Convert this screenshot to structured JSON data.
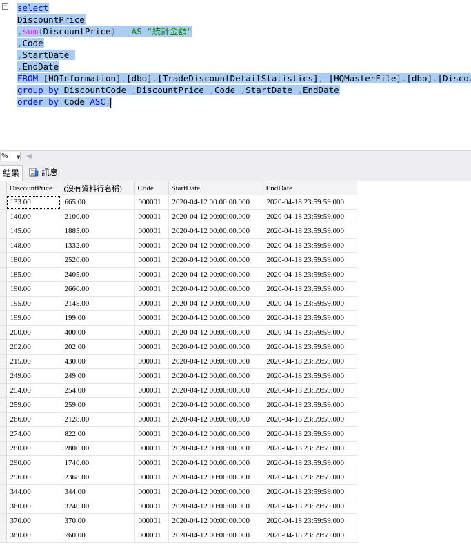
{
  "editor": {
    "lines": [
      {
        "parts": [
          {
            "cls": "kw",
            "text": "select"
          }
        ]
      },
      {
        "parts": [
          {
            "cls": "tx",
            "text": "DiscountPrice"
          }
        ]
      },
      {
        "parts": [
          {
            "cls": "op",
            "text": ","
          },
          {
            "cls": "fn",
            "text": "sum"
          },
          {
            "cls": "op",
            "text": "("
          },
          {
            "cls": "tx",
            "text": "DiscountPrice"
          },
          {
            "cls": "op",
            "text": ")"
          },
          {
            "cls": "tx",
            "text": " "
          },
          {
            "cls": "cm",
            "text": "--AS \"統計金額\""
          }
        ]
      },
      {
        "parts": [
          {
            "cls": "op",
            "text": ","
          },
          {
            "cls": "tx",
            "text": "Code"
          }
        ]
      },
      {
        "parts": [
          {
            "cls": "op",
            "text": ","
          },
          {
            "cls": "tx",
            "text": "StartDate "
          }
        ]
      },
      {
        "parts": [
          {
            "cls": "op",
            "text": ","
          },
          {
            "cls": "tx",
            "text": "EndDate"
          }
        ]
      },
      {
        "parts": [
          {
            "cls": "kw",
            "text": "FROM"
          },
          {
            "cls": "tx",
            "text": " [HQInformation]"
          },
          {
            "cls": "op",
            "text": "."
          },
          {
            "cls": "tx",
            "text": "[dbo]"
          },
          {
            "cls": "op",
            "text": "."
          },
          {
            "cls": "tx",
            "text": "[TradeDiscountDetailStatistics]"
          },
          {
            "cls": "op",
            "text": ","
          },
          {
            "cls": "tx",
            "text": " [HQMasterFile]"
          },
          {
            "cls": "op",
            "text": "."
          },
          {
            "cls": "tx",
            "text": "[dbo]"
          },
          {
            "cls": "op",
            "text": "."
          },
          {
            "cls": "tx",
            "text": "[Discount]"
          }
        ]
      },
      {
        "parts": [
          {
            "cls": "kw",
            "text": "group by"
          },
          {
            "cls": "tx",
            "text": " DiscountCode "
          },
          {
            "cls": "op",
            "text": ","
          },
          {
            "cls": "tx",
            "text": "DiscountPrice "
          },
          {
            "cls": "op",
            "text": ","
          },
          {
            "cls": "tx",
            "text": "Code "
          },
          {
            "cls": "op",
            "text": ","
          },
          {
            "cls": "tx",
            "text": "StartDate "
          },
          {
            "cls": "op",
            "text": ","
          },
          {
            "cls": "tx",
            "text": "EndDate"
          }
        ]
      },
      {
        "parts": [
          {
            "cls": "kw",
            "text": "order by"
          },
          {
            "cls": "tx",
            "text": " Code "
          },
          {
            "cls": "kw",
            "text": "ASC"
          },
          {
            "cls": "op",
            "text": ";"
          }
        ],
        "caret": true
      }
    ]
  },
  "zoom": {
    "value": "%"
  },
  "tabs": {
    "results": "結果",
    "messages": "訊息"
  },
  "grid": {
    "columns": [
      "DiscountPrice",
      "(沒有資料行名稱)",
      "Code",
      "StartDate",
      "EndDate"
    ],
    "rows": [
      [
        "133.00",
        "665.00",
        "000001",
        "2020-04-12 00:00:00.000",
        "2020-04-18 23:59:59.000"
      ],
      [
        "140.00",
        "2100.00",
        "000001",
        "2020-04-12 00:00:00.000",
        "2020-04-18 23:59:59.000"
      ],
      [
        "145.00",
        "1885.00",
        "000001",
        "2020-04-12 00:00:00.000",
        "2020-04-18 23:59:59.000"
      ],
      [
        "148.00",
        "1332.00",
        "000001",
        "2020-04-12 00:00:00.000",
        "2020-04-18 23:59:59.000"
      ],
      [
        "180.00",
        "2520.00",
        "000001",
        "2020-04-12 00:00:00.000",
        "2020-04-18 23:59:59.000"
      ],
      [
        "185.00",
        "2405.00",
        "000001",
        "2020-04-12 00:00:00.000",
        "2020-04-18 23:59:59.000"
      ],
      [
        "190.00",
        "2660.00",
        "000001",
        "2020-04-12 00:00:00.000",
        "2020-04-18 23:59:59.000"
      ],
      [
        "195.00",
        "2145.00",
        "000001",
        "2020-04-12 00:00:00.000",
        "2020-04-18 23:59:59.000"
      ],
      [
        "199.00",
        "199.00",
        "000001",
        "2020-04-12 00:00:00.000",
        "2020-04-18 23:59:59.000"
      ],
      [
        "200.00",
        "400.00",
        "000001",
        "2020-04-12 00:00:00.000",
        "2020-04-18 23:59:59.000"
      ],
      [
        "202.00",
        "202.00",
        "000001",
        "2020-04-12 00:00:00.000",
        "2020-04-18 23:59:59.000"
      ],
      [
        "215.00",
        "430.00",
        "000001",
        "2020-04-12 00:00:00.000",
        "2020-04-18 23:59:59.000"
      ],
      [
        "249.00",
        "249.00",
        "000001",
        "2020-04-12 00:00:00.000",
        "2020-04-18 23:59:59.000"
      ],
      [
        "254.00",
        "254.00",
        "000001",
        "2020-04-12 00:00:00.000",
        "2020-04-18 23:59:59.000"
      ],
      [
        "259.00",
        "259.00",
        "000001",
        "2020-04-12 00:00:00.000",
        "2020-04-18 23:59:59.000"
      ],
      [
        "266.00",
        "2128.00",
        "000001",
        "2020-04-12 00:00:00.000",
        "2020-04-18 23:59:59.000"
      ],
      [
        "274.00",
        "822.00",
        "000001",
        "2020-04-12 00:00:00.000",
        "2020-04-18 23:59:59.000"
      ],
      [
        "280.00",
        "2800.00",
        "000001",
        "2020-04-12 00:00:00.000",
        "2020-04-18 23:59:59.000"
      ],
      [
        "290.00",
        "1740.00",
        "000001",
        "2020-04-12 00:00:00.000",
        "2020-04-18 23:59:59.000"
      ],
      [
        "296.00",
        "2368.00",
        "000001",
        "2020-04-12 00:00:00.000",
        "2020-04-18 23:59:59.000"
      ],
      [
        "344.00",
        "344.00",
        "000001",
        "2020-04-12 00:00:00.000",
        "2020-04-18 23:59:59.000"
      ],
      [
        "360.00",
        "3240.00",
        "000001",
        "2020-04-12 00:00:00.000",
        "2020-04-18 23:59:59.000"
      ],
      [
        "370.00",
        "370.00",
        "000001",
        "2020-04-12 00:00:00.000",
        "2020-04-18 23:59:59.000"
      ],
      [
        "380.00",
        "760.00",
        "000001",
        "2020-04-12 00:00:00.000",
        "2020-04-18 23:59:59.000"
      ]
    ]
  }
}
